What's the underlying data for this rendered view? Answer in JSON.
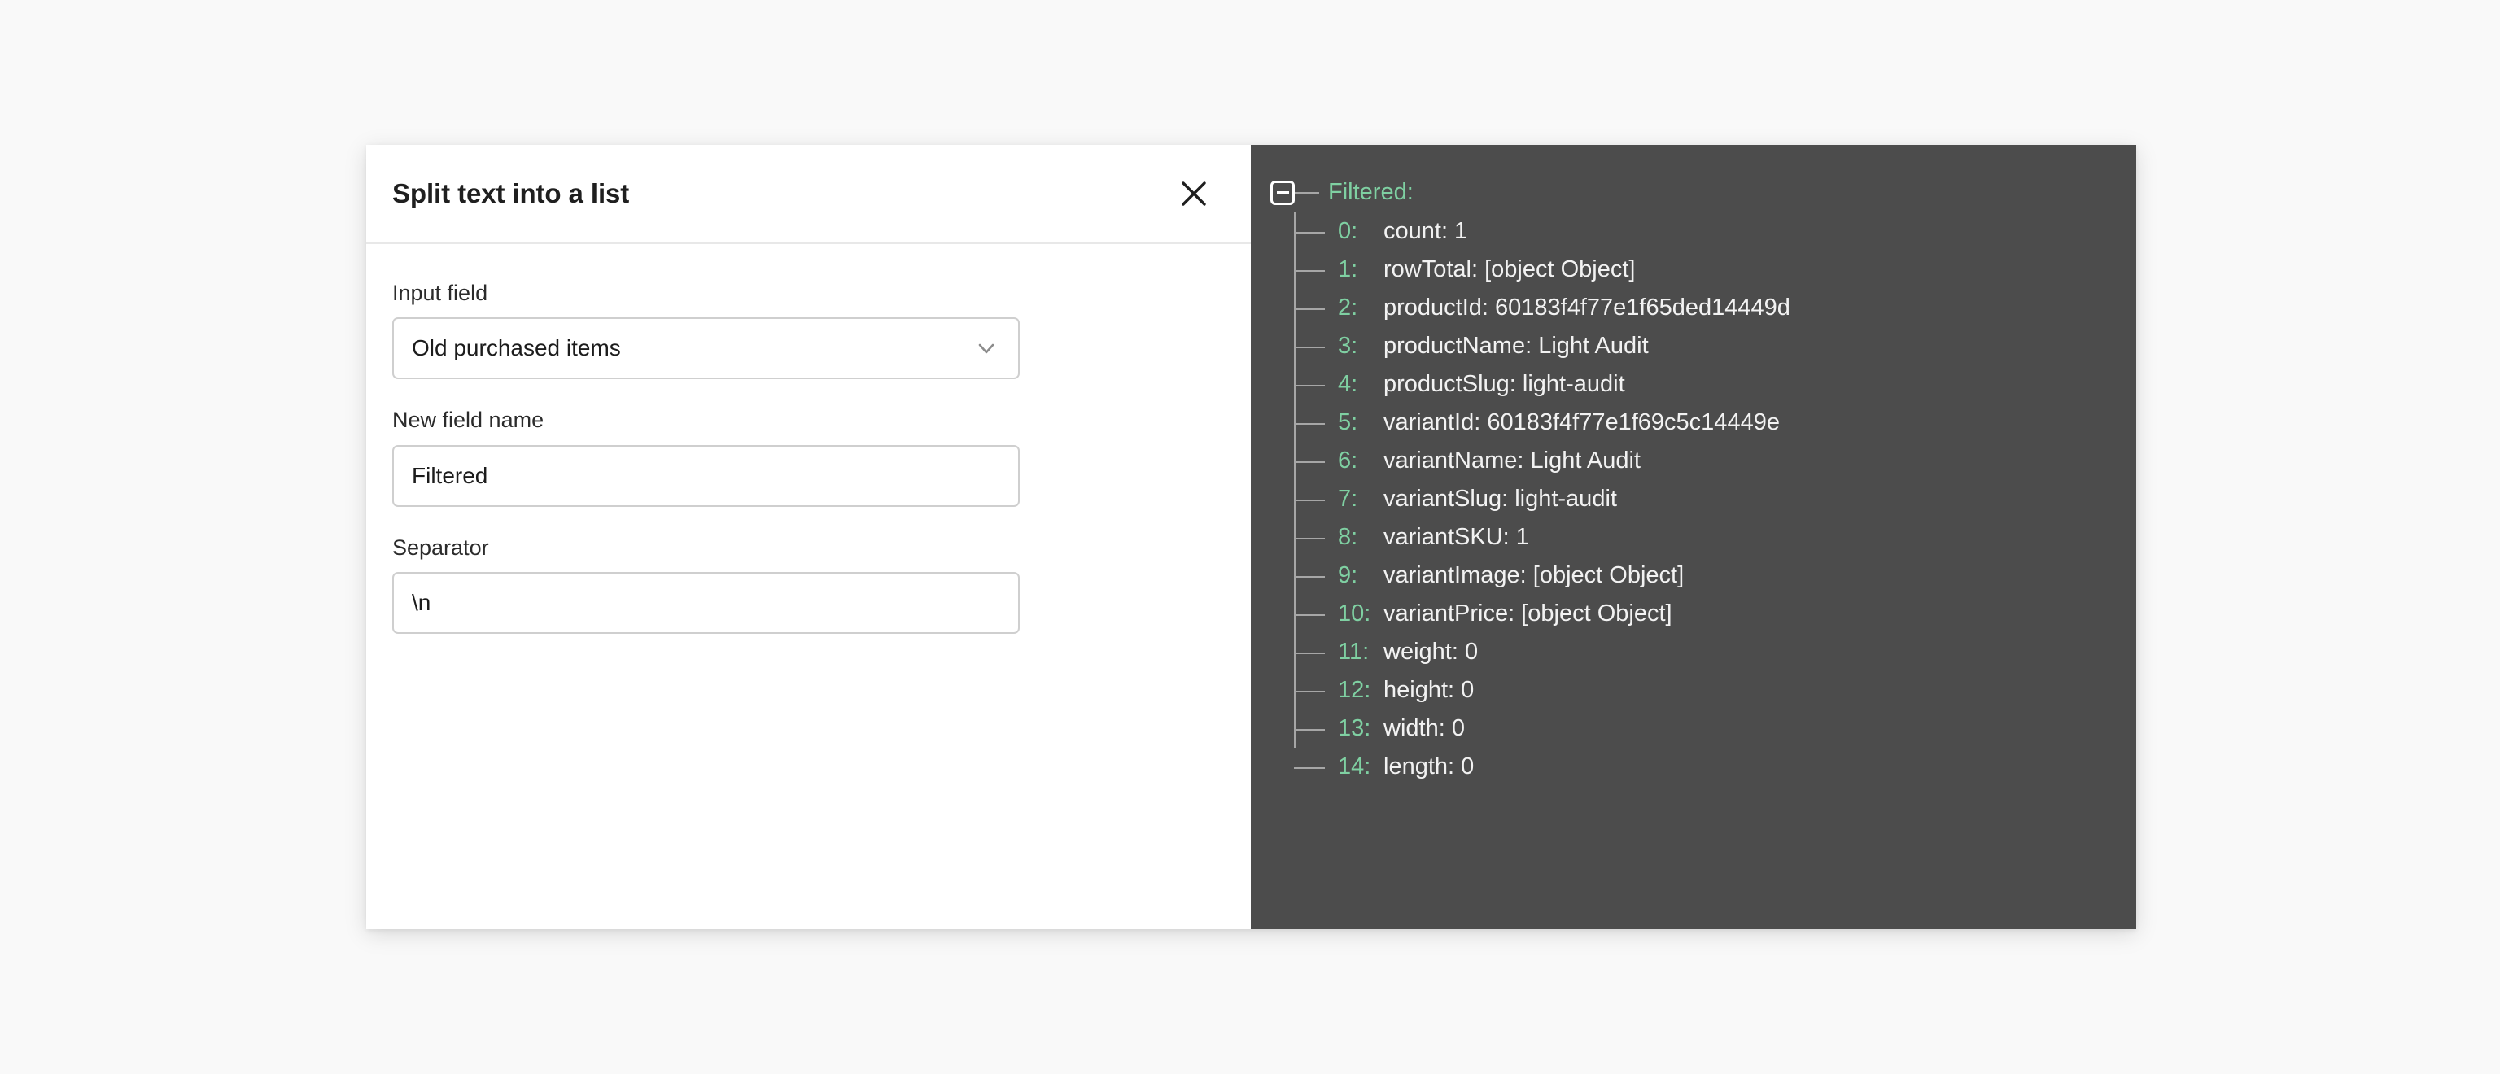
{
  "page": {
    "background_color": "#f9f9f9"
  },
  "modal": {
    "title": "Split text into a list",
    "close_icon": "close-icon",
    "fields": [
      {
        "label": "Input field",
        "type": "select",
        "value": "Old purchased items",
        "icon": "chevron-down-icon"
      },
      {
        "label": "New field name",
        "type": "text",
        "value": "Filtered",
        "placeholder": ""
      },
      {
        "label": "Separator",
        "type": "text",
        "value": "\\n",
        "placeholder": ""
      }
    ]
  },
  "tree": {
    "background_color": "#4c4c4c",
    "key_color": "#7fd0a2",
    "value_color": "#f2f2f2",
    "toggle_icon": "collapse-minus-icon",
    "toggle_state": "expanded",
    "root_label": "Filtered:",
    "items": [
      {
        "index": "0:",
        "text": "count: 1"
      },
      {
        "index": "1:",
        "text": "rowTotal: [object Object]"
      },
      {
        "index": "2:",
        "text": "productId: 60183f4f77e1f65ded14449d"
      },
      {
        "index": "3:",
        "text": "productName: Light Audit"
      },
      {
        "index": "4:",
        "text": "productSlug: light-audit"
      },
      {
        "index": "5:",
        "text": "variantId: 60183f4f77e1f69c5c14449e"
      },
      {
        "index": "6:",
        "text": "variantName: Light Audit"
      },
      {
        "index": "7:",
        "text": "variantSlug: light-audit"
      },
      {
        "index": "8:",
        "text": "variantSKU: 1"
      },
      {
        "index": "9:",
        "text": "variantImage: [object Object]"
      },
      {
        "index": "10:",
        "text": "variantPrice: [object Object]"
      },
      {
        "index": "11:",
        "text": "weight: 0"
      },
      {
        "index": "12:",
        "text": "height: 0"
      },
      {
        "index": "13:",
        "text": "width: 0"
      },
      {
        "index": "14:",
        "text": "length: 0"
      }
    ]
  }
}
